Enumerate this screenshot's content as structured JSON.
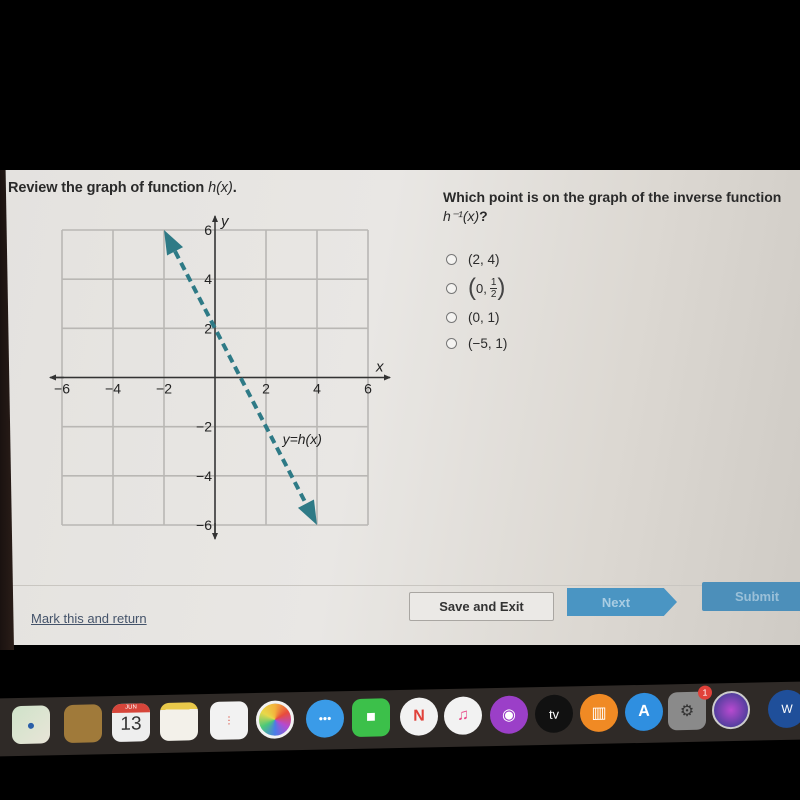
{
  "question": {
    "left_prompt_prefix": "Review the graph of function ",
    "left_prompt_fn": "h(x)",
    "left_prompt_suffix": ".",
    "right_prompt_line1": "Which point is on the graph of the inverse function",
    "right_prompt_fn": "h⁻¹(x)",
    "right_prompt_suffix": "?",
    "options": [
      {
        "label": "(2, 4)",
        "type": "text"
      },
      {
        "label": "(0, 1/2)",
        "type": "fraction",
        "prefix": "0,",
        "numerator": "1",
        "denominator": "2"
      },
      {
        "label": "(0, 1)",
        "type": "text"
      },
      {
        "label": "(−5, 1)",
        "type": "text"
      }
    ],
    "selected_option": null
  },
  "chart_data": {
    "type": "line",
    "title": "",
    "xlabel": "x",
    "ylabel": "y",
    "xlim": [
      -6,
      6
    ],
    "ylim": [
      -6,
      6
    ],
    "grid": true,
    "grid_step": 2,
    "x_tick_labels": [
      "−6",
      "−4",
      "−2",
      "2",
      "4",
      "6"
    ],
    "x_tick_values": [
      -6,
      -4,
      -2,
      2,
      4,
      6
    ],
    "y_tick_labels": [
      "6",
      "4",
      "2",
      "−2",
      "−4",
      "−6"
    ],
    "y_tick_values": [
      6,
      4,
      2,
      -2,
      -4,
      -6
    ],
    "series": [
      {
        "name": "y=h(x)",
        "style": "dashed-with-arrows",
        "color": "#2e7a86",
        "points": [
          [
            -2,
            6
          ],
          [
            4,
            -6
          ]
        ],
        "equation": "y = -2x + 2"
      }
    ],
    "annotations": [
      {
        "text": "y=h(x)",
        "x": 3.2,
        "y": -2.7
      }
    ]
  },
  "footer": {
    "mark_link": "Mark this and return",
    "save_exit": "Save and Exit",
    "next": "Next",
    "submit": "Submit"
  },
  "colors": {
    "accent_button": "#4a95c3",
    "graph_line": "#2e7a86",
    "link": "#44536a"
  },
  "dock": {
    "items": [
      {
        "name": "maps",
        "icon": "maps-icon"
      },
      {
        "name": "contacts",
        "icon": "contacts-icon"
      },
      {
        "name": "calendar",
        "icon": "calendar-icon",
        "month": "JUN",
        "day": "13"
      },
      {
        "name": "notes",
        "icon": "notes-icon"
      },
      {
        "name": "reminders",
        "icon": "reminders-icon"
      },
      {
        "name": "photos",
        "icon": "photos-icon"
      },
      {
        "name": "messages",
        "icon": "messages-icon"
      },
      {
        "name": "facetime",
        "icon": "facetime-icon"
      },
      {
        "name": "news",
        "icon": "news-icon"
      },
      {
        "name": "music",
        "icon": "music-icon"
      },
      {
        "name": "podcasts",
        "icon": "podcasts-icon"
      },
      {
        "name": "tv",
        "icon": "tv-icon",
        "label": "tv"
      },
      {
        "name": "books",
        "icon": "books-icon"
      },
      {
        "name": "app-store",
        "icon": "app-store-icon"
      },
      {
        "name": "system-preferences",
        "icon": "gear-icon",
        "badge": "1"
      },
      {
        "name": "siri",
        "icon": "siri-icon"
      },
      {
        "name": "word",
        "icon": "word-icon",
        "label": "W"
      }
    ]
  }
}
